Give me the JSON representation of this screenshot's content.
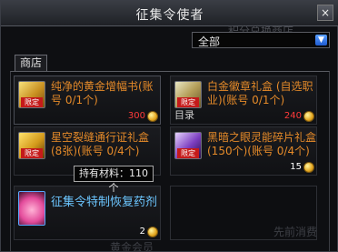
{
  "window": {
    "title": "征集令使者",
    "close_label": "×"
  },
  "filter": {
    "selected": "全部",
    "arrow": "▼"
  },
  "background_text": {
    "top": "积分兑换商店",
    "bottom_right": "先前消费",
    "bottom": "黄金会员"
  },
  "tabs": [
    {
      "label": "商店"
    }
  ],
  "items": [
    {
      "name": "纯净的黄金增幅书(账号 0/1个)",
      "badge": "限定",
      "price": "300",
      "price_color": "#ff3a3a",
      "name_color": "orange",
      "icon": "gold-book-icon",
      "selected": true
    },
    {
      "name": "白金徽章礼盒 (自选职业)(账号 0/1个)",
      "badge": "限定",
      "price": "240",
      "price_color": "#ff3a3a",
      "name_color": "orange",
      "icon": "platinum-badge-box-icon",
      "extra_label": "目录"
    },
    {
      "name": "星空裂缝通行证礼盒 (8张)(账号 0/4个)",
      "badge": "限定",
      "price": "",
      "price_color": "#ffffff",
      "name_color": "orange",
      "icon": "starry-pass-box-icon"
    },
    {
      "name": "黑暗之眼灵能碎片礼盒 (150个)(账号 0/4个)",
      "badge": "限定",
      "price": "15",
      "price_color": "#ffffff",
      "name_color": "orange",
      "icon": "dark-eye-shard-box-icon"
    },
    {
      "name": "征集令特制恢复药剂",
      "badge": "",
      "price": "2",
      "price_color": "#ffffff",
      "name_color": "blue",
      "icon": "recovery-potion-icon"
    }
  ],
  "tooltip": {
    "text": "持有材料：110个"
  },
  "colors": {
    "accent": "#e58a29",
    "name_blue": "#6cc6ff",
    "badge_red": "#c51a1a",
    "price_red": "#ff3a3a"
  }
}
